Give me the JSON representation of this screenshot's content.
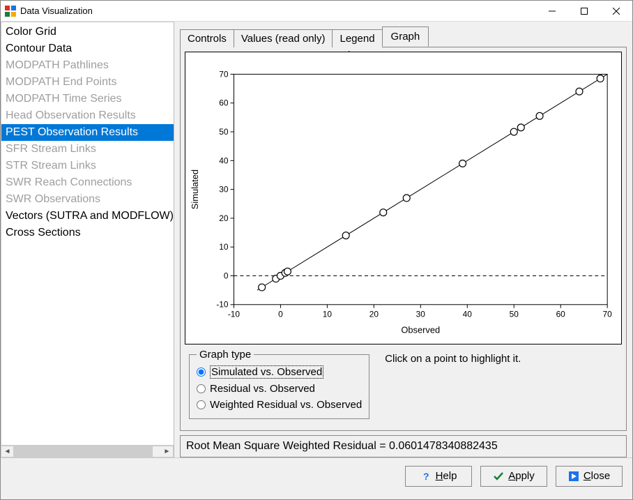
{
  "window": {
    "title": "Data Visualization"
  },
  "sidebar": {
    "items": [
      {
        "label": "Color Grid",
        "disabled": false
      },
      {
        "label": "Contour Data",
        "disabled": false
      },
      {
        "label": "MODPATH Pathlines",
        "disabled": true
      },
      {
        "label": "MODPATH End Points",
        "disabled": true
      },
      {
        "label": "MODPATH Time Series",
        "disabled": true
      },
      {
        "label": "Head Observation Results",
        "disabled": true
      },
      {
        "label": "PEST Observation Results",
        "disabled": false,
        "selected": true
      },
      {
        "label": "SFR Stream Links",
        "disabled": true
      },
      {
        "label": "STR Stream Links",
        "disabled": true
      },
      {
        "label": "SWR Reach Connections",
        "disabled": true
      },
      {
        "label": "SWR Observations",
        "disabled": true
      },
      {
        "label": "Vectors (SUTRA and MODFLOW)",
        "disabled": false
      },
      {
        "label": "Cross Sections",
        "disabled": false
      }
    ]
  },
  "tabs": {
    "items": [
      "Controls",
      "Values (read only)",
      "Legend",
      "Graph"
    ],
    "active_index": 3
  },
  "graph_type": {
    "legend_label": "Graph type",
    "options": [
      "Simulated vs. Observed",
      "Residual vs. Observed",
      "Weighted Residual vs. Observed"
    ],
    "selected_index": 0
  },
  "hint_text": "Click on a point to highlight it.",
  "status_text": "Root Mean Square Weighted Residual = 0.0601478340882435",
  "buttons": {
    "help": "Help",
    "apply": "Apply",
    "close": "Close"
  },
  "chart_data": {
    "type": "scatter",
    "title": "",
    "xlabel": "Observed",
    "ylabel": "Simulated",
    "xlim": [
      -10,
      70
    ],
    "ylim": [
      -10,
      70
    ],
    "xticks": [
      -10,
      0,
      10,
      20,
      30,
      40,
      50,
      60,
      70
    ],
    "yticks": [
      -10,
      0,
      10,
      20,
      30,
      40,
      50,
      60,
      70
    ],
    "series": [
      {
        "name": "points",
        "x": [
          -4,
          -1,
          0,
          1,
          1.5,
          14,
          22,
          27,
          39,
          50,
          51.5,
          55.5,
          64,
          68.5
        ],
        "y": [
          -4,
          -1,
          0,
          1,
          1.5,
          14,
          22,
          27,
          39,
          50,
          51.5,
          55.5,
          64,
          68.5
        ]
      }
    ],
    "reference_lines": [
      {
        "type": "identity",
        "x0": -5,
        "y0": -5,
        "x1": 70,
        "y1": 70
      },
      {
        "type": "hline",
        "y": 0,
        "style": "dashed"
      }
    ]
  }
}
